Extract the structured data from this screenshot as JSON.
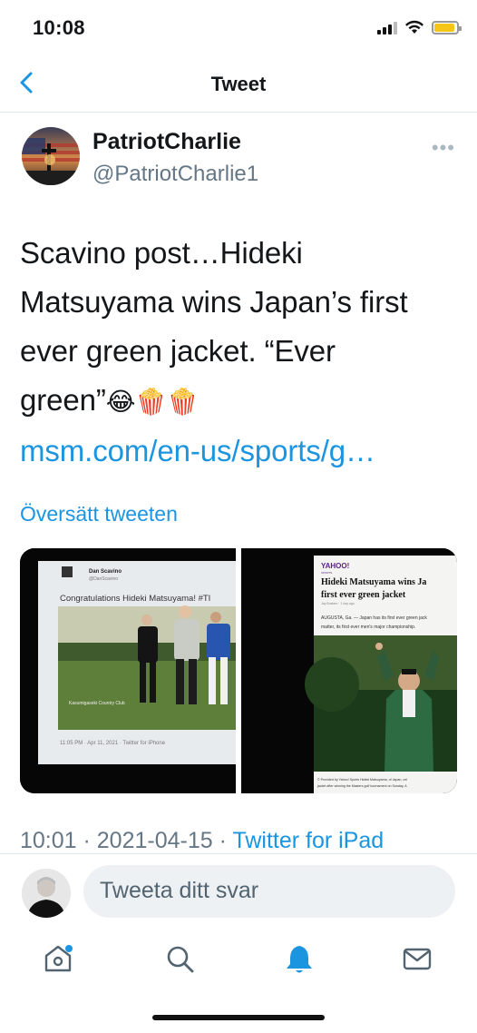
{
  "status_bar": {
    "time": "10:08",
    "battery_level": 0.9
  },
  "nav": {
    "title": "Tweet"
  },
  "author": {
    "display_name": "PatriotCharlie",
    "handle": "@PatriotCharlie1"
  },
  "tweet": {
    "text_lines": [
      "Scavino post…Hideki",
      "Matsuyama wins Japan’s first",
      "ever green jacket.  “Ever",
      "green”"
    ],
    "emojis": "😂🍿🍿",
    "link": "msm.com/en-us/sports/g…",
    "translate_label": "Översätt tweeten"
  },
  "media": {
    "left": {
      "name": "Dan Scavino",
      "handle": "@DanScavino",
      "text": "Congratulations Hideki Matsuyama! #TI",
      "caption": "Kasumigaseki Country Club",
      "timestamp": "11:05 PM · Apr 11, 2021 · Twitter for iPhone"
    },
    "right": {
      "brand": "YAHOO!",
      "brand_sub": "SPORTS",
      "headline_1": "Hideki Matsuyama wins Ja",
      "headline_2": "first ever green jacket",
      "byline": "Jay Busbee · 1 day ago",
      "body_1": "AUGUSTA, Ga. — Japan has its first ever green jack",
      "body_2": "matter, its first ever men's major championship.",
      "credit_1": "© Provided by Yahoo! Sports  Hideki Matsuyama, of Japan, cel",
      "credit_2": "jacket after winning the Masters golf tournament on Sunday, A"
    }
  },
  "meta": {
    "time": "10:01",
    "date": "2021-04-15",
    "separator": " · ",
    "source": "Twitter for iPad"
  },
  "reply": {
    "placeholder": "Tweeta ditt svar"
  },
  "tabs": [
    {
      "name": "home-tab",
      "icon": "home-icon"
    },
    {
      "name": "search-tab",
      "icon": "search-icon"
    },
    {
      "name": "notifications-tab",
      "icon": "bell-icon"
    },
    {
      "name": "messages-tab",
      "icon": "mail-icon"
    }
  ],
  "colors": {
    "accent": "#1b95e0",
    "text": "#14171a",
    "muted": "#657786"
  }
}
